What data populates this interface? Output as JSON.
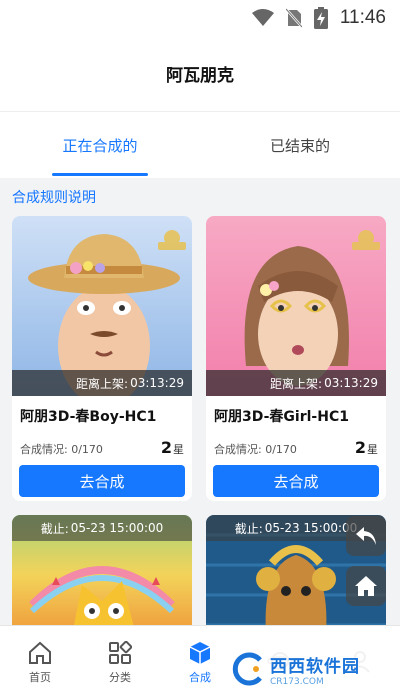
{
  "status_bar": {
    "time": "11:46"
  },
  "header": {
    "title": "阿瓦朋克"
  },
  "tabs": [
    {
      "label": "正在合成的"
    },
    {
      "label": "已结束的"
    }
  ],
  "rules_link": "合成规则说明",
  "cards": [
    {
      "countdown_label": "距离上架:",
      "countdown_time": "03:13:29",
      "name": "阿朋3D-春Boy-HC1",
      "progress_label": "合成情况:",
      "progress_value": "0/170",
      "star_count": "2",
      "star_unit": "星",
      "button": "去合成"
    },
    {
      "countdown_label": "距离上架:",
      "countdown_time": "03:13:29",
      "name": "阿朋3D-春Girl-HC1",
      "progress_label": "合成情况:",
      "progress_value": "0/170",
      "star_count": "2",
      "star_unit": "星",
      "button": "去合成"
    },
    {
      "deadline_label": "截止:",
      "deadline_time": "05-23 15:00:00"
    },
    {
      "deadline_label": "截止:",
      "deadline_time": "05-23 15:00:00"
    }
  ],
  "bottom_nav": [
    {
      "label": "首页",
      "icon": "home-icon"
    },
    {
      "label": "分类",
      "icon": "category-icon"
    },
    {
      "label": "合成",
      "icon": "cube-icon"
    },
    {
      "label": "",
      "icon": "planet-icon"
    },
    {
      "label": "",
      "icon": "user-icon"
    }
  ],
  "watermark": {
    "title": "西西软件园",
    "subtitle": "CR173.COM"
  },
  "colors": {
    "accent": "#1677ff",
    "card_bg": "#ffffff",
    "page_bg": "#f2f3f5"
  }
}
